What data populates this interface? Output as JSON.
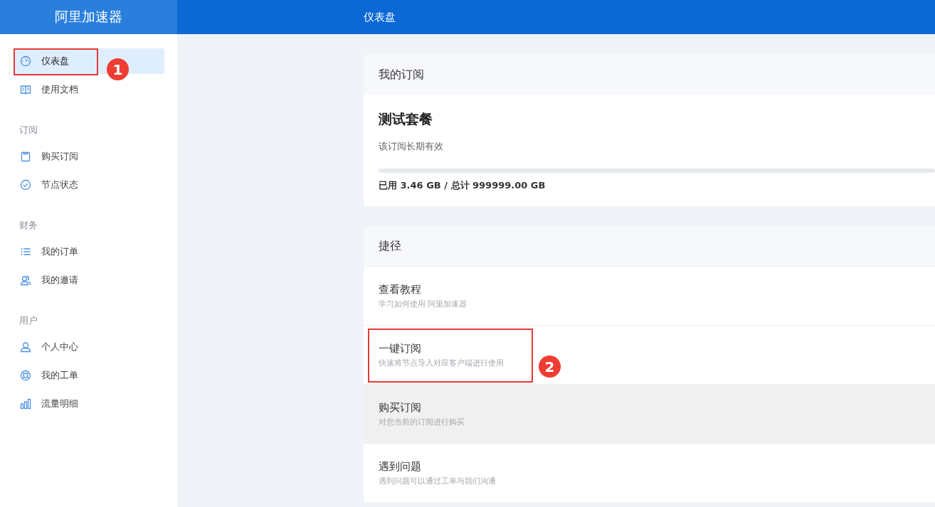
{
  "brand": "阿里加速器",
  "page_title": "仪表盘",
  "sidebar": {
    "groups": [
      {
        "items": [
          {
            "label": "仪表盘",
            "kind": "gauge",
            "selected": true,
            "callout": "1"
          },
          {
            "label": "使用文档",
            "kind": "book",
            "selected": false
          }
        ]
      },
      {
        "label": "订阅",
        "items": [
          {
            "label": "购买订阅",
            "kind": "bag",
            "selected": false
          },
          {
            "label": "节点状态",
            "kind": "check",
            "selected": false
          }
        ]
      },
      {
        "label": "财务",
        "items": [
          {
            "label": "我的订单",
            "kind": "list",
            "selected": false
          },
          {
            "label": "我的邀请",
            "kind": "users",
            "selected": false
          }
        ]
      },
      {
        "label": "用户",
        "items": [
          {
            "label": "个人中心",
            "kind": "user",
            "selected": false
          },
          {
            "label": "我的工单",
            "kind": "lifebuoy",
            "selected": false
          },
          {
            "label": "流量明细",
            "kind": "bars",
            "selected": false
          }
        ]
      }
    ]
  },
  "subscription": {
    "heading": "我的订阅",
    "plan": "测试套餐",
    "validity": "该订阅长期有效",
    "level": 0.0,
    "usage": "已用 3.46 GB / 总计 999999.00 GB"
  },
  "shortcuts": {
    "heading": "捷径",
    "items": [
      {
        "title": "查看教程",
        "description": "学习如何使用 阿里加速器",
        "highlighted": false
      },
      {
        "title": "一键订阅",
        "description": "快速将节点导入对应客户端进行使用",
        "highlighted": false,
        "callout": "2"
      },
      {
        "title": "购买订阅",
        "description": "对您当前的订阅进行购买",
        "highlighted": true
      },
      {
        "title": "遇到问题",
        "description": "遇到问题可以通过工单与我们沟通",
        "highlighted": false
      }
    ]
  }
}
